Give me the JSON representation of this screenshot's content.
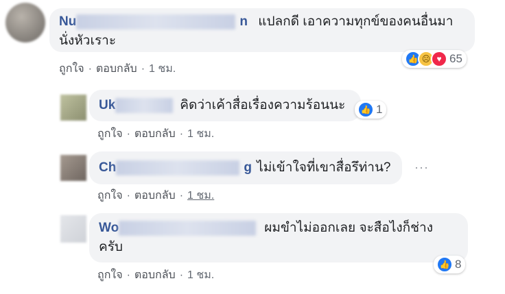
{
  "comments": [
    {
      "name_visible": "Nu",
      "name_tail": "n",
      "text_line1": "แปลกดี เอาความทุกข์ของคนอื่นมา",
      "text_line2": "นั่งหัวเราะ",
      "reaction_icons": [
        "like-icon",
        "sad-icon",
        "love-icon"
      ],
      "reaction_count": "65",
      "like_label": "ถูกใจ",
      "reply_label": "ตอบกลับ",
      "time_label": "1 ชม."
    },
    {
      "name_visible": "Uk",
      "text_line1": "คิดว่าเค้าสื่อเรื่องความร้อนนะ",
      "reaction_icons": [
        "like-icon"
      ],
      "reaction_count": "1",
      "like_label": "ถูกใจ",
      "reply_label": "ตอบกลับ",
      "time_label": "1 ชม."
    },
    {
      "name_visible": "Ch",
      "name_tail": "g",
      "text_line1": "ไม่เข้าใจที่เขาสื่อรึท่าน?",
      "more_label": "···",
      "like_label": "ถูกใจ",
      "reply_label": "ตอบกลับ",
      "time_label": "1 ชม."
    },
    {
      "name_visible": "Wo",
      "text_line1": "ผมขำไม่ออกเลย จะสือไงก็ช่าง",
      "text_line2": "ครับ",
      "reaction_icons": [
        "like-icon"
      ],
      "reaction_count": "8",
      "like_label": "ถูกใจ",
      "reply_label": "ตอบกลับ",
      "time_label": "1 ชม."
    }
  ],
  "separator": "·",
  "colors": {
    "name": "#385898",
    "bubble": "#f2f3f5",
    "meta": "#616770",
    "like": "#2078f4",
    "love": "#f0284a",
    "sad": "#f7c343"
  }
}
